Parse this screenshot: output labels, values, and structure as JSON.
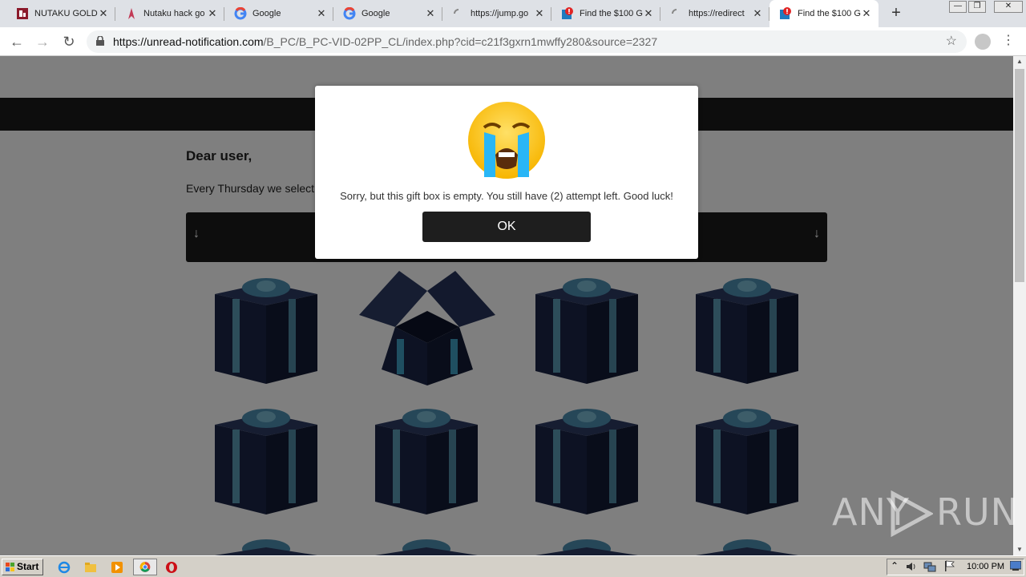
{
  "browser": {
    "tabs": [
      {
        "title": "NUTAKU GOLD",
        "favicon": "nutaku-icon"
      },
      {
        "title": "Nutaku hack go",
        "favicon": "nutaku-hack-icon"
      },
      {
        "title": "Google",
        "favicon": "google-icon"
      },
      {
        "title": "Google",
        "favicon": "google-icon"
      },
      {
        "title": "https://jump.go",
        "favicon": "loading-icon"
      },
      {
        "title": "Find the $100 G",
        "favicon": "alert-icon"
      },
      {
        "title": "https://redirect",
        "favicon": "loading-icon"
      },
      {
        "title": "Find the $100 G",
        "favicon": "alert-icon"
      }
    ],
    "active_tab_index": 7,
    "tab_close_glyph": "✕",
    "new_tab_glyph": "+",
    "url_domain": "https://unread-notification.com",
    "url_path": "/B_PC/B_PC-VID-02PP_CL/index.php?cid=c21f3gxrn1mwffy280&source=2327",
    "nav": {
      "back": "←",
      "forward": "→",
      "reload": "↻",
      "bookmark": "☆",
      "menu": "⋮"
    },
    "window_controls": {
      "minimize": "—",
      "restore": "❐",
      "close": "✕"
    }
  },
  "page": {
    "greeting": "Dear user,",
    "paragraph_visible": "Every Thursday we select",
    "banner_arrow_left": "↓",
    "banner_arrow_right": "↓",
    "gifts": [
      {
        "state": "closed"
      },
      {
        "state": "open"
      },
      {
        "state": "closed"
      },
      {
        "state": "closed"
      },
      {
        "state": "closed"
      },
      {
        "state": "closed"
      },
      {
        "state": "closed"
      },
      {
        "state": "closed"
      }
    ],
    "gift_colors": {
      "box": "#1a2446",
      "ribbon": "#5b9bb5"
    }
  },
  "modal": {
    "emoji": "loudly-crying-face-icon",
    "message": "Sorry, but this gift box is empty. You still have (2) attempt left. Good luck!",
    "ok_label": "OK"
  },
  "watermark": {
    "left": "ANY",
    "right": "RUN"
  },
  "taskbar": {
    "start_label": "Start",
    "quicklaunch": [
      "ie-icon",
      "folder-icon",
      "media-player-icon",
      "chrome-icon",
      "opera-icon"
    ],
    "clock": "10:00 PM",
    "tray_expand": "⌃"
  }
}
